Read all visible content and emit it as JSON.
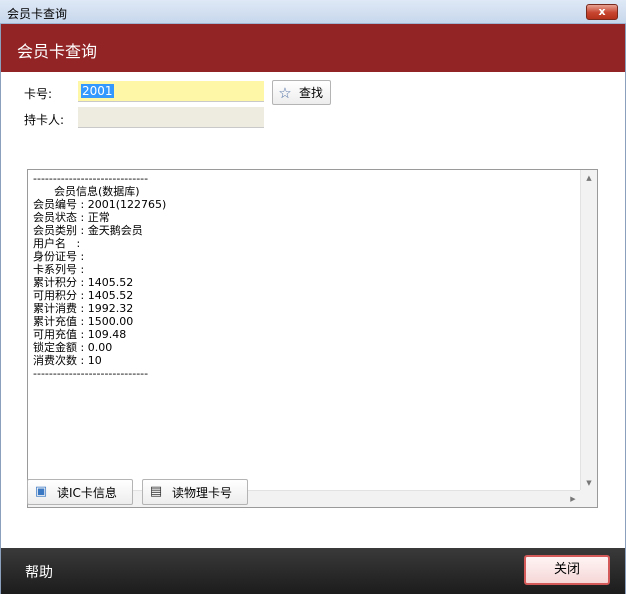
{
  "window": {
    "title": "会员卡查询",
    "close_glyph": "x"
  },
  "header": {
    "title": "会员卡查询"
  },
  "form": {
    "card_label": "卡号:",
    "card_value": "2001",
    "holder_label": "持卡人:",
    "holder_value": "",
    "search_label": "查找",
    "search_icon": "star-icon"
  },
  "info": {
    "lines": [
      "-----------------------------",
      "      会员信息(数据库)",
      "会员编号 : 2001(122765)",
      "会员状态 : 正常",
      "会员类别 : 金天鹅会员",
      "用户名   :",
      "身份证号 :",
      "卡系列号 :",
      "累计积分 : 1405.52",
      "可用积分 : 1405.52",
      "累计消费 : 1992.32",
      "累计充值 : 1500.00",
      "可用充值 : 109.48",
      "锁定金额 : 0.00",
      "消费次数 : 10",
      "-----------------------------"
    ]
  },
  "buttons": {
    "read_ic": "读IC卡信息",
    "read_physical": "读物理卡号",
    "close": "关闭"
  },
  "footer": {
    "help": "帮助"
  },
  "colors": {
    "header_bg": "#922426",
    "card_input_bg": "#fff7a8",
    "footer_bg": "#1c1c1c"
  }
}
